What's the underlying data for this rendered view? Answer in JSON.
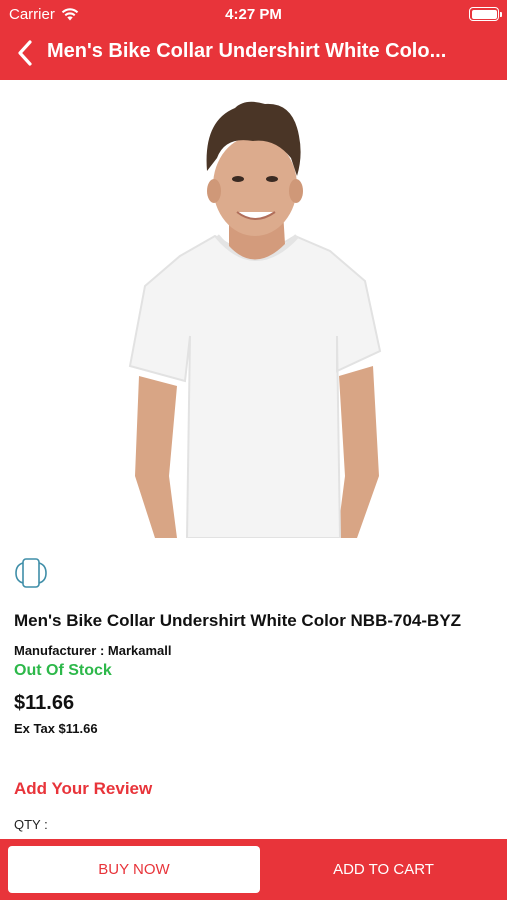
{
  "status_bar": {
    "carrier": "Carrier",
    "time": "4:27 PM",
    "icons": [
      "wifi-icon",
      "battery-icon"
    ]
  },
  "nav": {
    "title": "Men's Bike Collar Undershirt White Colo...",
    "back_icon": "chevron-left-icon"
  },
  "product": {
    "image": "man-in-white-t-shirt",
    "rotate_icon": "rotate-360-icon",
    "name": "Men's Bike Collar Undershirt White Color NBB-704-BYZ",
    "manufacturer": "Manufacturer : Markamall",
    "stock_status": "Out Of Stock",
    "price": "$11.66",
    "ex_tax": "Ex Tax $11.66"
  },
  "review": {
    "link_label": "Add Your Review"
  },
  "qty": {
    "label": "QTY :"
  },
  "actions": {
    "buy_now": "BUY NOW",
    "add_to_cart": "ADD TO CART"
  },
  "colors": {
    "brand_red": "#e8343a",
    "stock_green": "#2db84a"
  }
}
